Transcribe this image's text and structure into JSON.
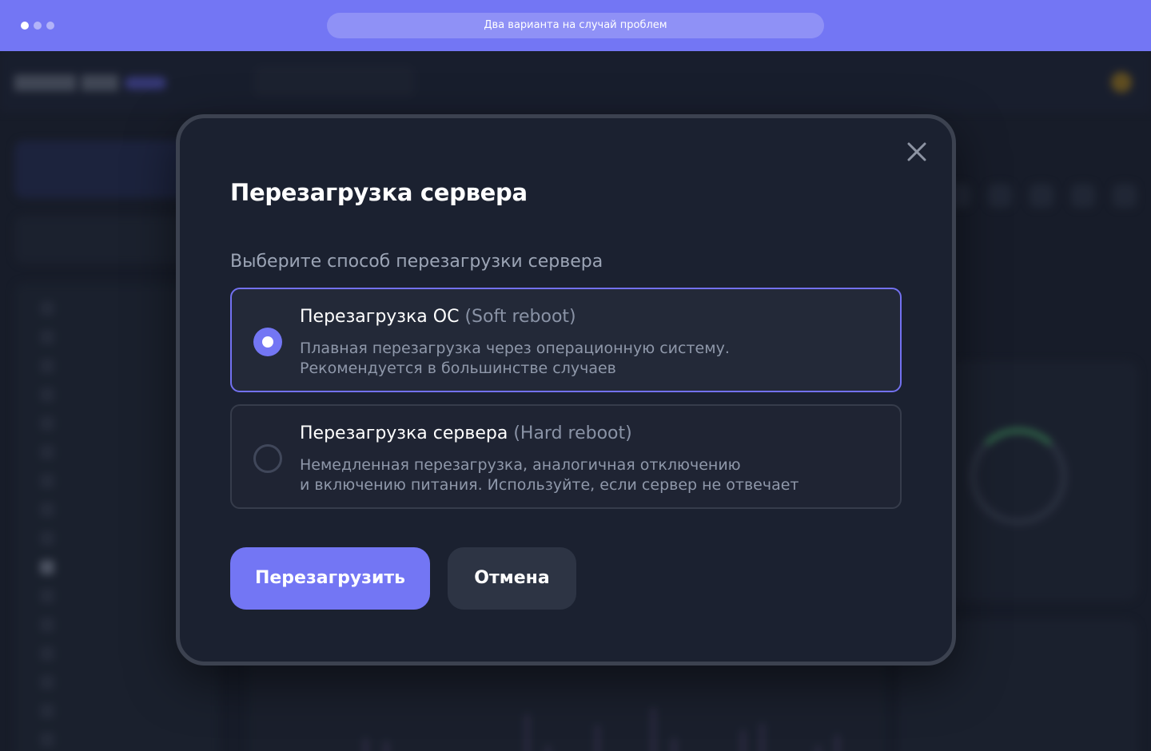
{
  "browser": {
    "tab_title": "Два варианта на случай проблем"
  },
  "modal": {
    "title": "Перезагрузка сервера",
    "subtitle": "Выберите способ перезагрузки сервера",
    "options": [
      {
        "title": "Перезагрузка ОС",
        "hint": "(Soft reboot)",
        "desc_line1": "Плавная перезагрузка через операционную систему.",
        "desc_line2": "Рекомендуется в большинстве случаев",
        "selected": true
      },
      {
        "title": "Перезагрузка сервера",
        "hint": "(Hard reboot)",
        "desc_line1": "Немедленная перезагрузка, аналогичная отключению",
        "desc_line2": "и включению питания. Используйте, если сервер не отвечает",
        "selected": false
      }
    ],
    "primary_label": "Перезагрузить",
    "cancel_label": "Отмена"
  },
  "colors": {
    "accent": "#7376f4",
    "modal_bg": "#1b2130",
    "selected_border": "#7371f0"
  },
  "icons": {
    "close": "close-icon",
    "radio_selected": "radio-checked-icon",
    "radio_unselected": "radio-unchecked-icon"
  }
}
